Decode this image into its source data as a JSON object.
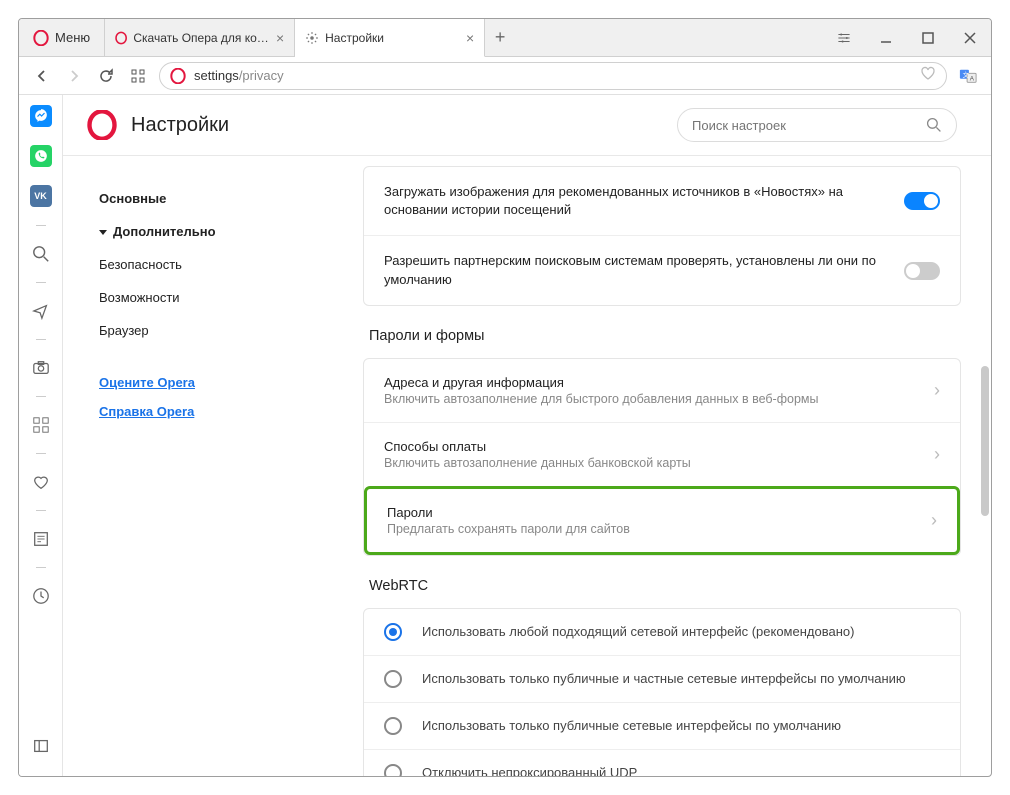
{
  "menu_label": "Меню",
  "tabs": [
    {
      "title": "Скачать Опера для компьютера"
    },
    {
      "title": "Настройки"
    }
  ],
  "address": {
    "prefix": "settings",
    "suffix": "/privacy"
  },
  "page_title": "Настройки",
  "search": {
    "placeholder": "Поиск настроек"
  },
  "nav": {
    "basic": "Основные",
    "advanced": "Дополнительно",
    "security": "Безопасность",
    "features": "Возможности",
    "browser": "Браузер",
    "rate": "Оцените Opera",
    "help": "Справка Opera"
  },
  "top_rows": {
    "images": "Загружать изображения для рекомендованных источников в «Новостях» на основании истории посещений",
    "partners": "Разрешить партнерским поисковым системам проверять, установлены ли они по умолчанию"
  },
  "sections": {
    "passwords_forms": "Пароли и формы",
    "webrtc": "WebRTC"
  },
  "pf": {
    "addresses_title": "Адреса и другая информация",
    "addresses_sub": "Включить автозаполнение для быстрого добавления данных в веб-формы",
    "payment_title": "Способы оплаты",
    "payment_sub": "Включить автозаполнение данных банковской карты",
    "passwords_title": "Пароли",
    "passwords_sub": "Предлагать сохранять пароли для сайтов"
  },
  "webrtc": {
    "opt1": "Использовать любой подходящий сетевой интерфейс (рекомендовано)",
    "opt2": "Использовать только публичные и частные сетевые интерфейсы по умолчанию",
    "opt3": "Использовать только публичные сетевые интерфейсы по умолчанию",
    "opt4": "Отключить непроксированный UDP"
  },
  "icons": {
    "messenger": "messenger",
    "whatsapp": "whatsapp",
    "vk": "vk"
  },
  "colors": {
    "accent": "#0a84ff",
    "link": "#1a73e8",
    "highlight": "#4ca91a"
  }
}
